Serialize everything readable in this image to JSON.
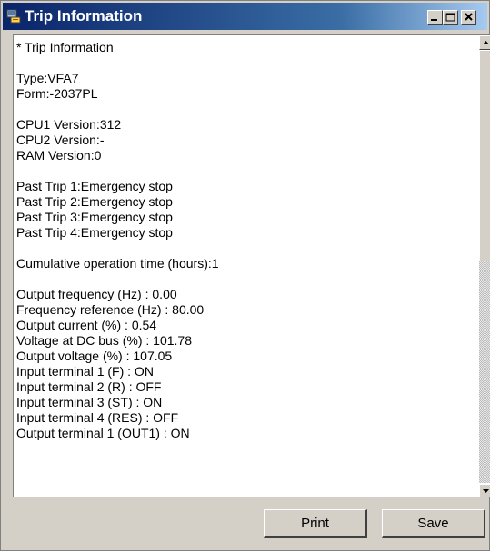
{
  "window": {
    "title": "Trip Information",
    "icon": "app-icon"
  },
  "titlebar_buttons": [
    "minimize-icon",
    "maximize-icon",
    "close-icon"
  ],
  "content": {
    "lines": [
      "* Trip Information",
      "",
      "Type:VFA7",
      "Form:-2037PL",
      "",
      "CPU1 Version:312",
      "CPU2 Version:-",
      "RAM Version:0",
      "",
      "Past Trip 1:Emergency stop",
      "Past Trip 2:Emergency stop",
      "Past Trip 3:Emergency stop",
      "Past Trip 4:Emergency stop",
      "",
      "Cumulative operation time (hours):1",
      "",
      "Output frequency (Hz) : 0.00",
      "Frequency reference (Hz) : 80.00",
      "Output current (%) : 0.54",
      "Voltage at DC bus (%) : 101.78",
      "Output voltage (%) : 107.05",
      "Input terminal 1 (F) : ON",
      "Input terminal 2 (R) : OFF",
      "Input terminal 3 (ST) : ON",
      "Input terminal 4 (RES) : OFF",
      "Output terminal 1 (OUT1) : ON"
    ]
  },
  "buttons": {
    "print_label": "Print",
    "save_label": "Save"
  }
}
